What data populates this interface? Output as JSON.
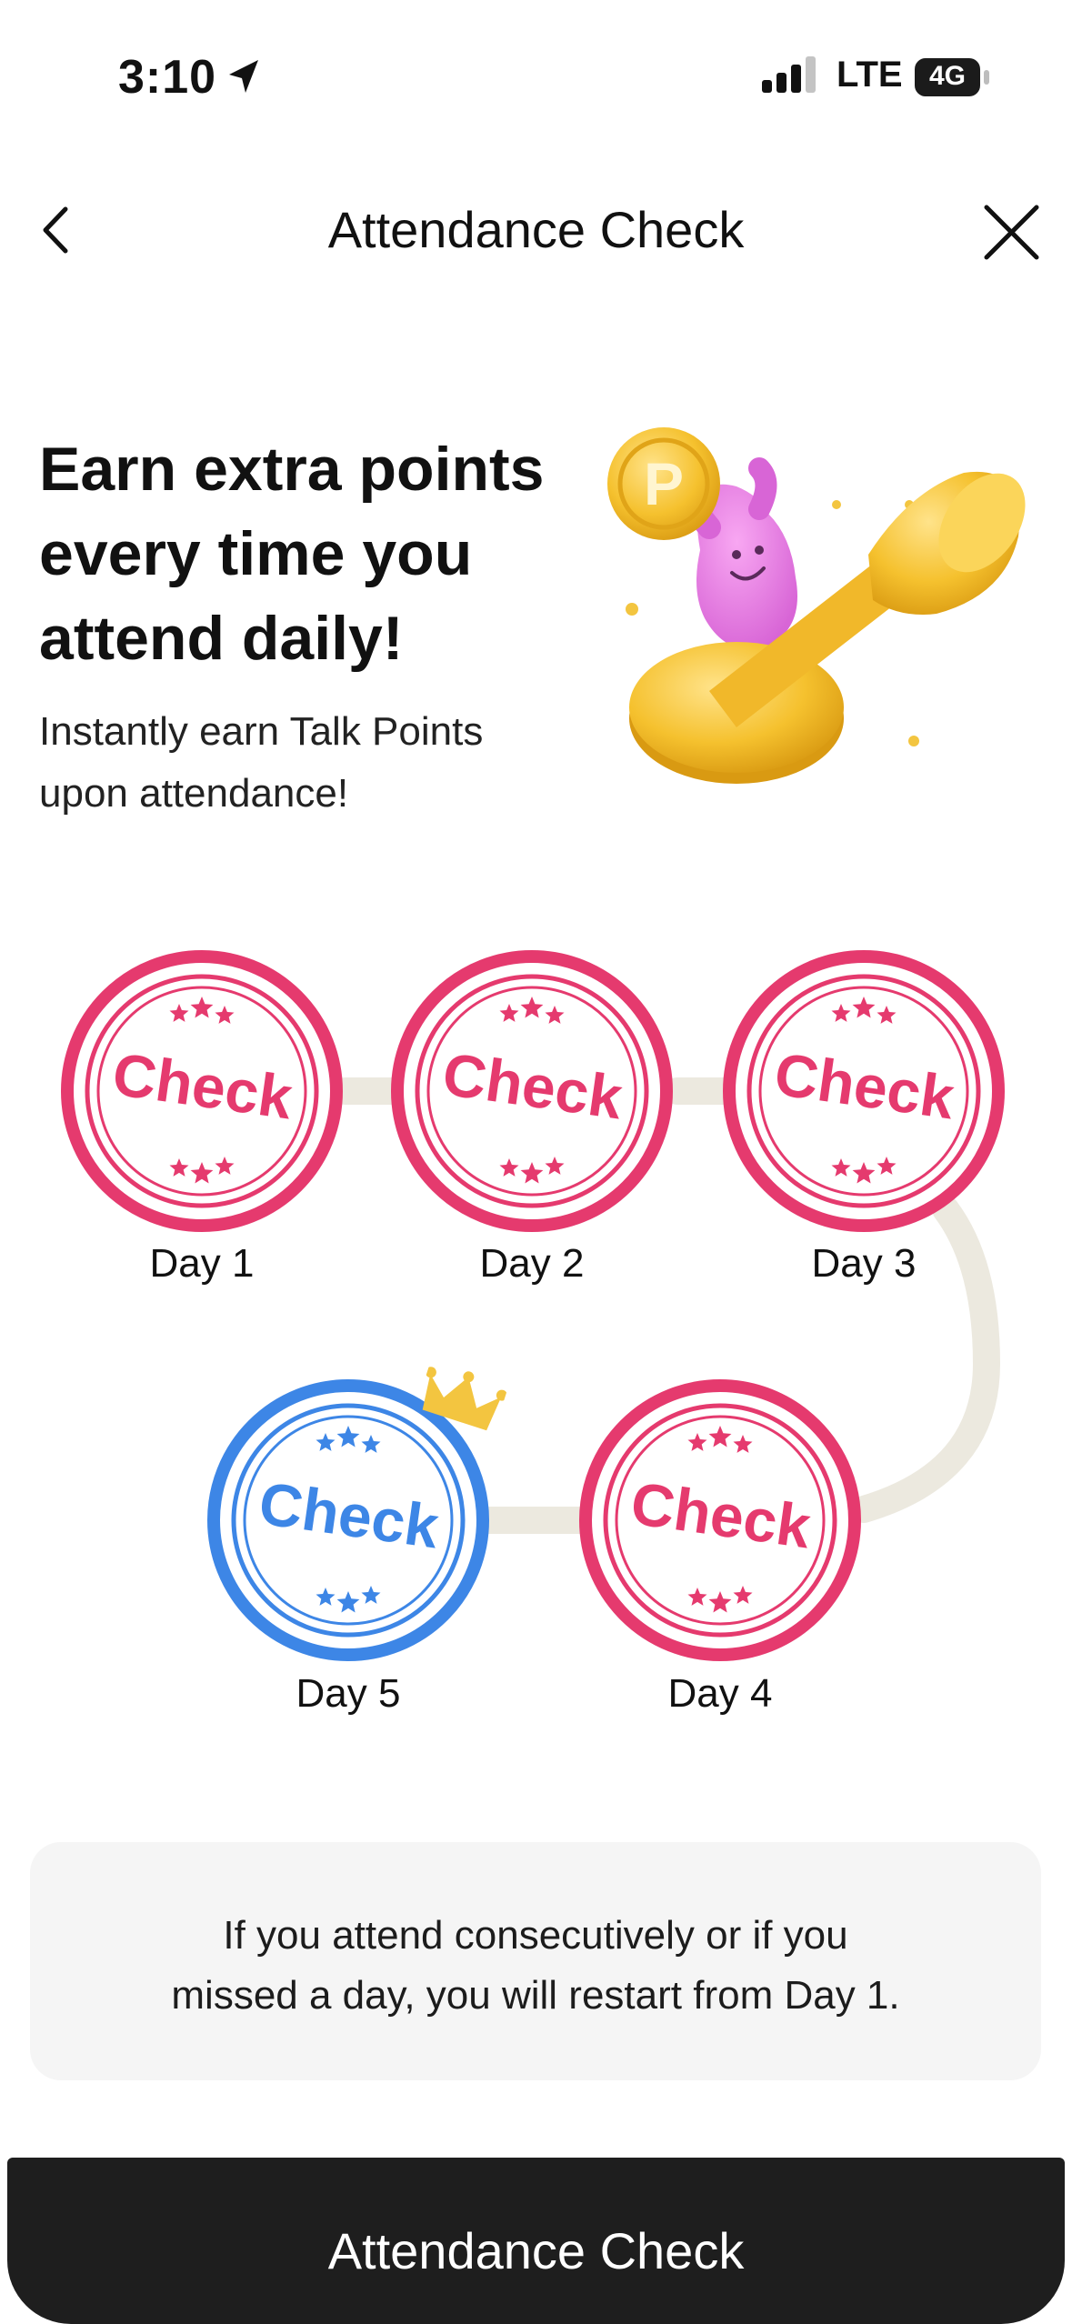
{
  "status_bar": {
    "time": "3:10",
    "network": "LTE",
    "battery_label": "4G"
  },
  "nav": {
    "title": "Attendance Check",
    "back_icon": "chevron-left-icon",
    "close_icon": "close-icon"
  },
  "hero": {
    "headline_lines": [
      "Earn extra points",
      "every time you",
      "attend daily!"
    ],
    "subline_lines": [
      "Instantly earn Talk Points",
      "upon attendance!"
    ],
    "illustration": {
      "coin_letter": "P"
    }
  },
  "stamps": {
    "stamp_text": "Check",
    "days": [
      {
        "label": "Day 1",
        "color": "#e53a6e"
      },
      {
        "label": "Day 2",
        "color": "#e53a6e"
      },
      {
        "label": "Day 3",
        "color": "#e53a6e"
      },
      {
        "label": "Day 4",
        "color": "#e53a6e"
      },
      {
        "label": "Day 5",
        "color": "#3d86e6"
      }
    ],
    "path_color": "#ece9df",
    "crown_color": "#f3c540"
  },
  "notice": {
    "lines": [
      "If you attend consecutively or if you",
      "missed a day, you will restart from Day 1."
    ]
  },
  "cta": {
    "label": "Attendance Check"
  }
}
